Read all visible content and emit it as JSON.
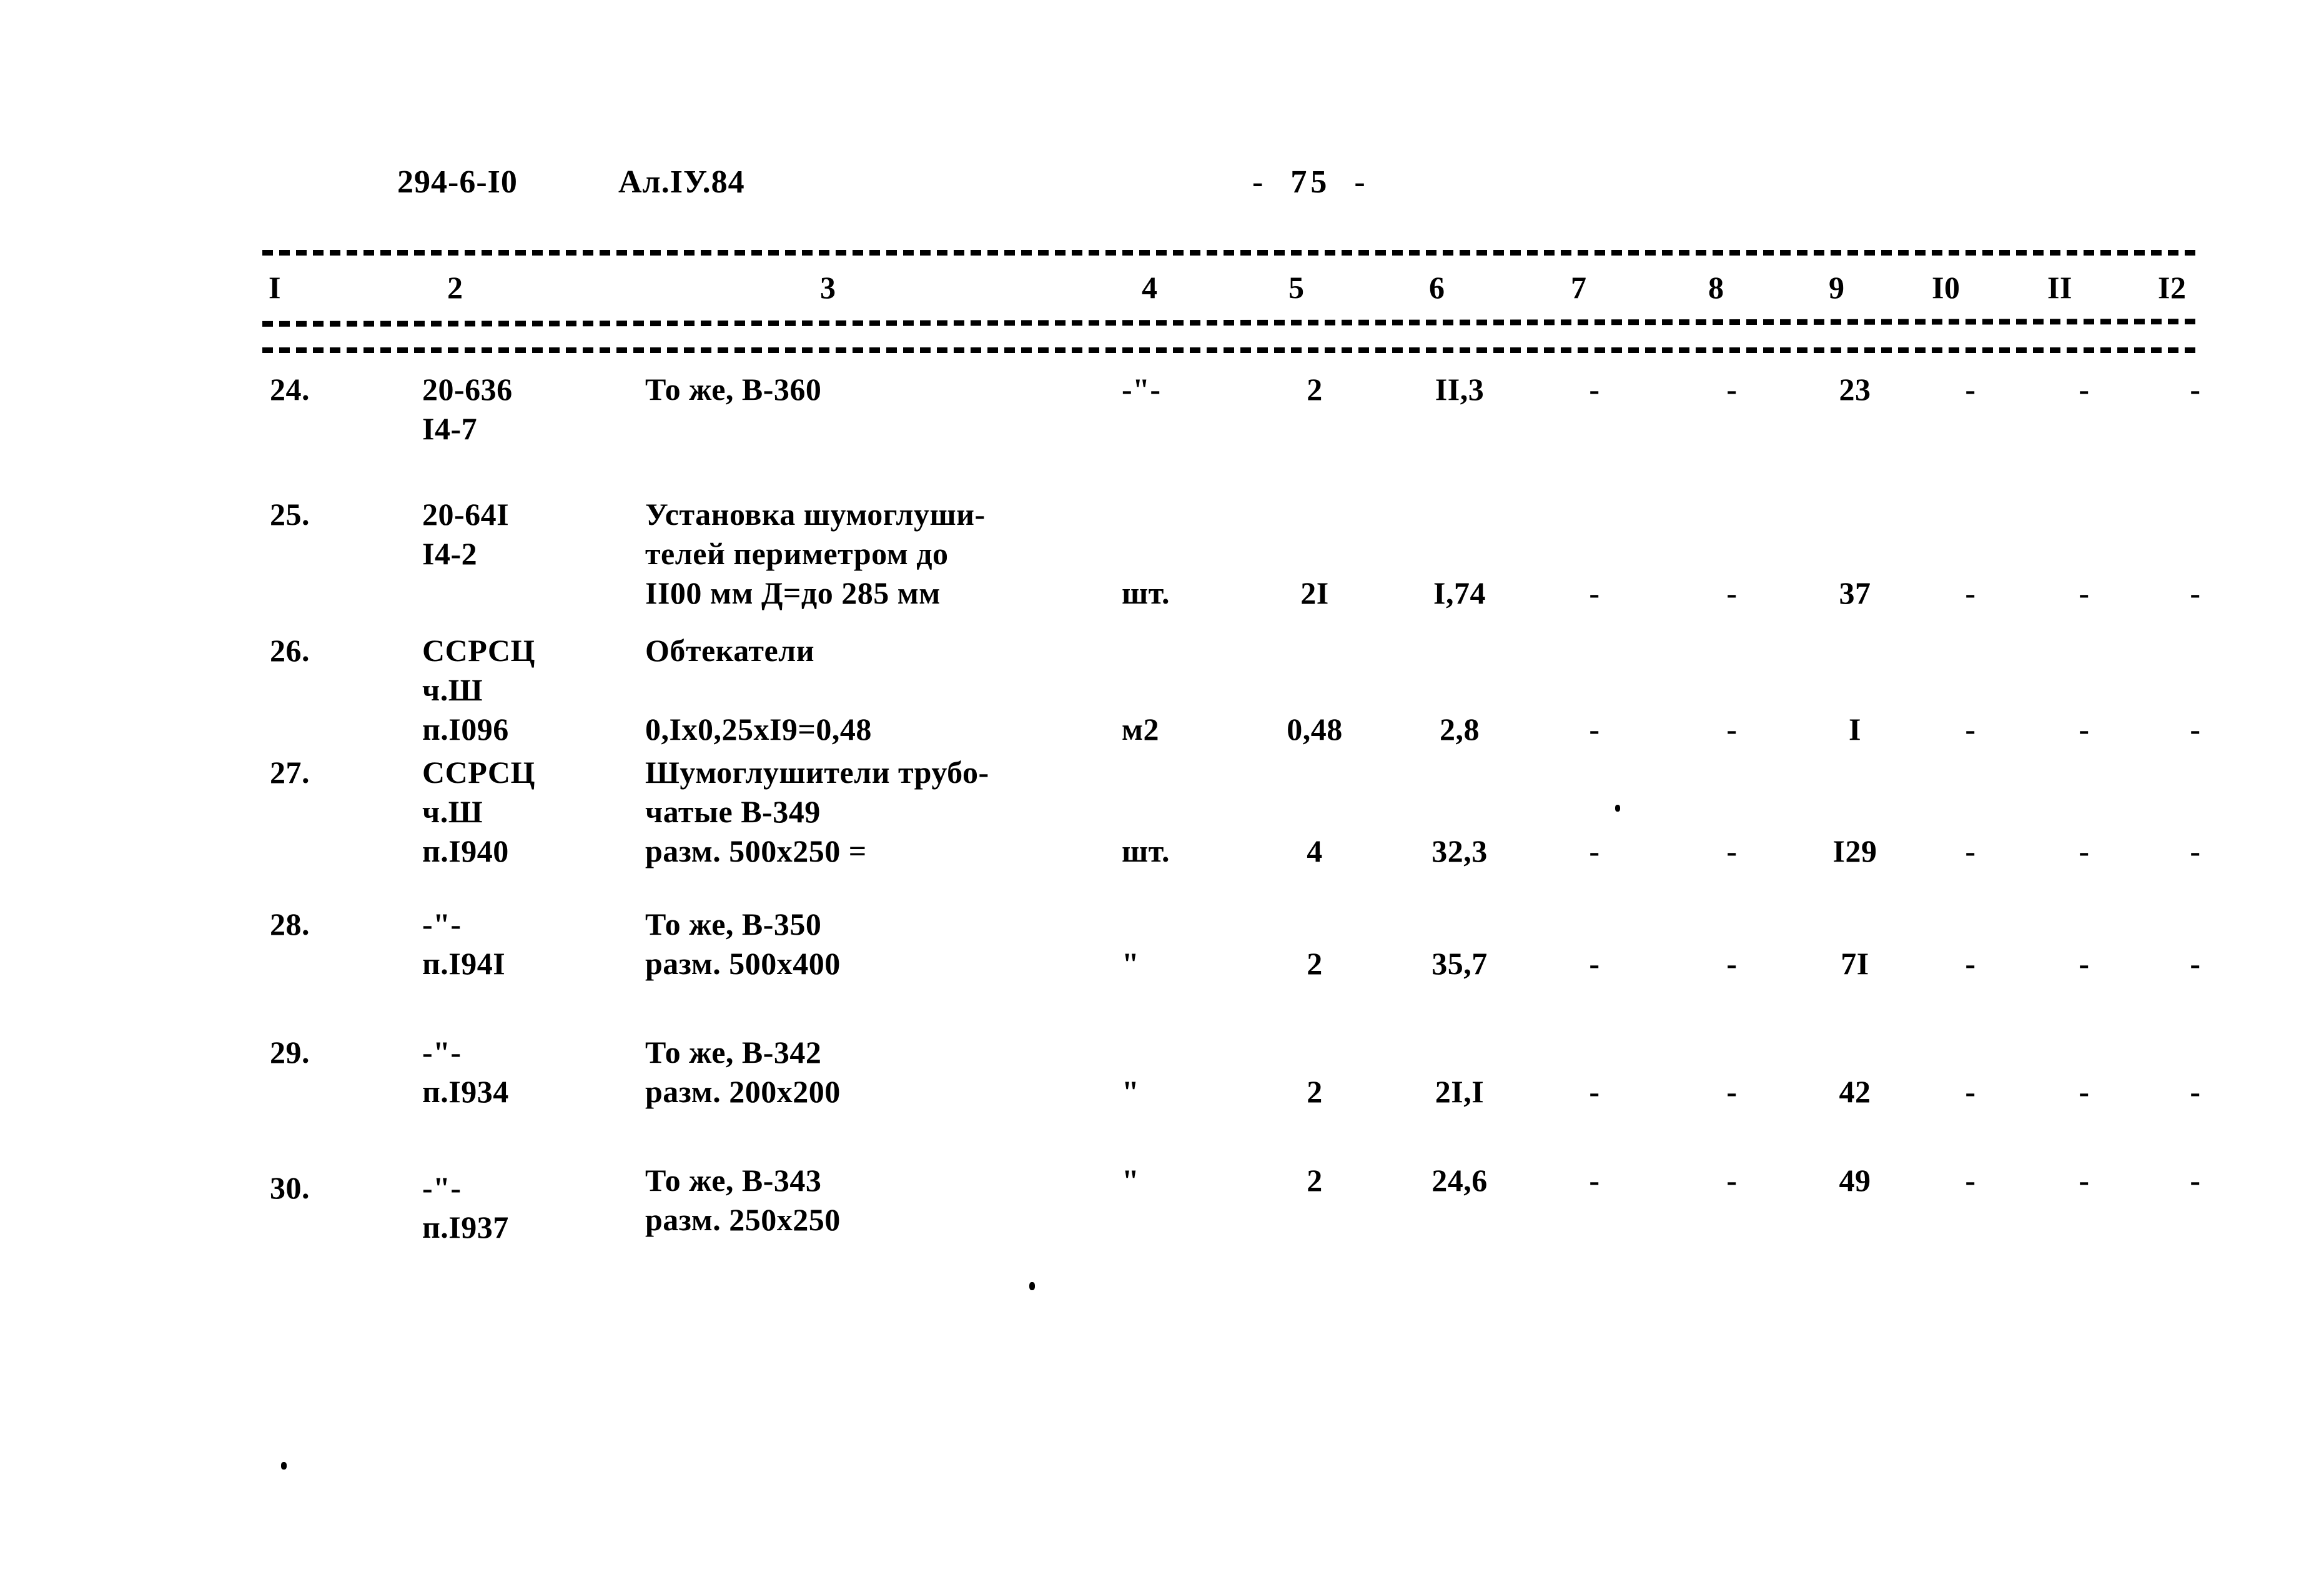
{
  "header": {
    "doc_code": "294-6-I0",
    "album": "Ал.IУ.84",
    "page_number": "-  75  -"
  },
  "table": {
    "column_numbers": [
      "I",
      "2",
      "3",
      "4",
      "5",
      "6",
      "7",
      "8",
      "9",
      "I0",
      "II",
      "I2"
    ],
    "rows": [
      {
        "num": "24.",
        "code": "20-636\nI4-7",
        "description": "То же, В-360",
        "unit": "-\"-",
        "qty": "2",
        "price": "II,3",
        "c7": "-",
        "c8": "-",
        "total": "23",
        "c10": "-",
        "c11": "-",
        "c12": "-"
      },
      {
        "num": "25.",
        "code": "20-64I\nI4-2",
        "description": "Установка шумоглуши-\nтелей периметром до\nII00 мм Д=до 285 мм",
        "unit": "шт.",
        "qty": "2I",
        "price": "I,74",
        "c7": "-",
        "c8": "-",
        "total": "37",
        "c10": "-",
        "c11": "-",
        "c12": "-"
      },
      {
        "num": "26.",
        "code": "ССРСЦ\nч.Ш\nп.I096",
        "description": "Обтекатели\n\n0,Ix0,25xI9=0,48",
        "unit": "м2",
        "qty": "0,48",
        "price": "2,8",
        "c7": "-",
        "c8": "-",
        "total": "I",
        "c10": "-",
        "c11": "-",
        "c12": "-"
      },
      {
        "num": "27.",
        "code": "ССРСЦ\nч.Ш\nп.I940",
        "description": "Шумоглушители трубо-\nчатые В-349\nразм. 500х250 =",
        "unit": "шт.",
        "qty": "4",
        "price": "32,3",
        "c7": "-",
        "c8": "-",
        "total": "I29",
        "c10": "-",
        "c11": "-",
        "c12": "-"
      },
      {
        "num": "28.",
        "code": "-\"-\nп.I94I",
        "description": "То же, В-350\nразм. 500х400",
        "unit": "\"",
        "qty": "2",
        "price": "35,7",
        "c7": "-",
        "c8": "-",
        "total": "7I",
        "c10": "-",
        "c11": "-",
        "c12": "-"
      },
      {
        "num": "29.",
        "code": "-\"-\nп.I934",
        "description": "То же, В-342\nразм. 200х200",
        "unit": "\"",
        "qty": "2",
        "price": "2I,I",
        "c7": "-",
        "c8": "-",
        "total": "42",
        "c10": "-",
        "c11": "-",
        "c12": "-"
      },
      {
        "num": "30.",
        "code": "-\"-\nп.I937",
        "description": "То же, В-343\nразм. 250х250",
        "unit": "\"",
        "qty": "2",
        "price": "24,6",
        "c7": "-",
        "c8": "-",
        "total": "49",
        "c10": "-",
        "c11": "-",
        "c12": "-"
      }
    ]
  }
}
